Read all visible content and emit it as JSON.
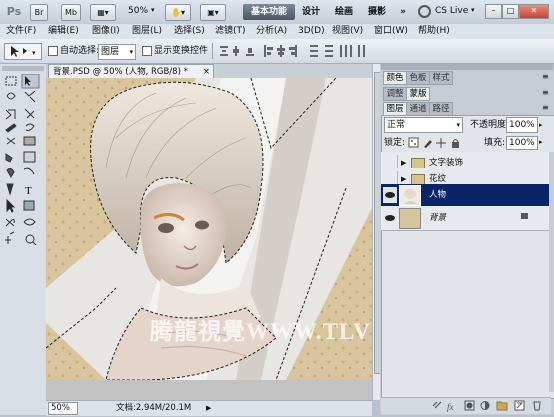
{
  "app": {
    "logo": "Ps",
    "bridge_label": "Br",
    "minibridge_label": "Mb",
    "zoom_dropdown": "50%",
    "workspace": {
      "basic": "基本功能",
      "design": "设计",
      "painting": "绘画",
      "photography": "摄影",
      "more": "»"
    },
    "cs_live": "CS Live"
  },
  "menu": [
    "文件(F)",
    "编辑(E)",
    "图像(I)",
    "图层(L)",
    "选择(S)",
    "滤镜(T)",
    "分析(A)",
    "3D(D)",
    "视图(V)",
    "窗口(W)",
    "帮助(H)"
  ],
  "options_bar": {
    "auto_select_label": "自动选择:",
    "auto_select_value": "图层",
    "show_transform_label": "显示变换控件"
  },
  "document": {
    "tab_title": "背景.PSD @ 50% (人物, RGB/8) *",
    "zoom": "50%",
    "doc_size": "文档:2.94M/20.1M"
  },
  "watermark": "腾龍視覺WWW.TLVI.NET",
  "panels": {
    "color_tabs": [
      "颜色",
      "色板",
      "样式"
    ],
    "adjust_tabs": [
      "调整",
      "蒙版"
    ],
    "layers_tabs": [
      "图层",
      "通道",
      "路径"
    ],
    "blend_mode": "正常",
    "opacity_label": "不透明度:",
    "opacity_value": "100%",
    "lock_label": "锁定:",
    "fill_label": "填充:",
    "fill_value": "100%",
    "layers": [
      {
        "name": "文字装饰",
        "type": "group",
        "visible": false
      },
      {
        "name": "花纹",
        "type": "group",
        "visible": false
      },
      {
        "name": "人物",
        "type": "layer",
        "visible": true,
        "selected": true
      },
      {
        "name": "背景",
        "type": "background",
        "visible": true,
        "locked": true
      }
    ]
  },
  "colors": {
    "accent_selected": "#0a246a",
    "foreground": "#000000",
    "background": "#ffffff"
  }
}
